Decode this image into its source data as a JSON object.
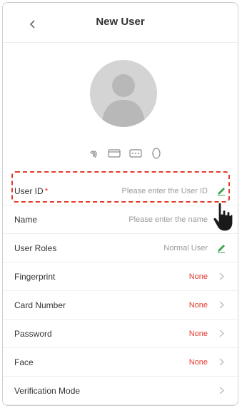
{
  "header": {
    "title": "New User"
  },
  "rows": [
    {
      "label": "User ID",
      "required": "*",
      "value": "Please enter the User ID",
      "trail": "edit"
    },
    {
      "label": "Name",
      "required": "",
      "value": "Please enter the name",
      "trail": "none"
    },
    {
      "label": "User Roles",
      "required": "",
      "value": "Normal User",
      "trail": "edit"
    },
    {
      "label": "Fingerprint",
      "required": "",
      "value": "None",
      "trail": "chevron"
    },
    {
      "label": "Card Number",
      "required": "",
      "value": "None",
      "trail": "chevron"
    },
    {
      "label": "Password",
      "required": "",
      "value": "None",
      "trail": "chevron"
    },
    {
      "label": "Face",
      "required": "",
      "value": "None",
      "trail": "chevron"
    },
    {
      "label": "Verification Mode",
      "required": "",
      "value": "",
      "trail": "chevron"
    }
  ],
  "icons": [
    "fingerprint-icon",
    "card-icon",
    "password-icon",
    "face-icon"
  ],
  "colors": {
    "accent": "#e23b2e",
    "edit": "#3fa34d",
    "text": "#333333",
    "muted": "#9a9a9a"
  }
}
